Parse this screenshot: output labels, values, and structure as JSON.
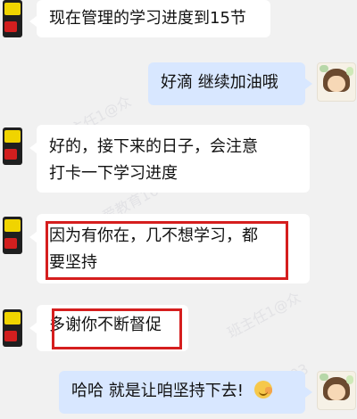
{
  "messages": [
    {
      "id": 1,
      "side": "left",
      "text": "现在管理的学习进度到15节"
    },
    {
      "id": 2,
      "side": "right",
      "text": "好滴 继续加油哦"
    },
    {
      "id": 3,
      "side": "left",
      "lines": [
        "好的，接下来的日子，会注意",
        "打卡一下学习进度"
      ]
    },
    {
      "id": 4,
      "side": "left",
      "lines": [
        "因为有你在，几不想学习，都",
        "要坚持"
      ],
      "highlighted": true
    },
    {
      "id": 5,
      "side": "left",
      "text": "多谢你不断督促",
      "highlighted": true
    },
    {
      "id": 6,
      "side": "right",
      "text": "哈哈 就是让咱坚持下去!",
      "emoji": "emoji-icon"
    }
  ],
  "watermark": {
    "lines": [
      "班主任1@众",
      "爱教育1603",
      "班主任1@众",
      "爱教育1603"
    ]
  },
  "colors": {
    "bg": "#f1f1f1",
    "left_bubble": "#ffffff",
    "right_bubble": "#d8e7ff",
    "highlight": "#d51e1e"
  }
}
